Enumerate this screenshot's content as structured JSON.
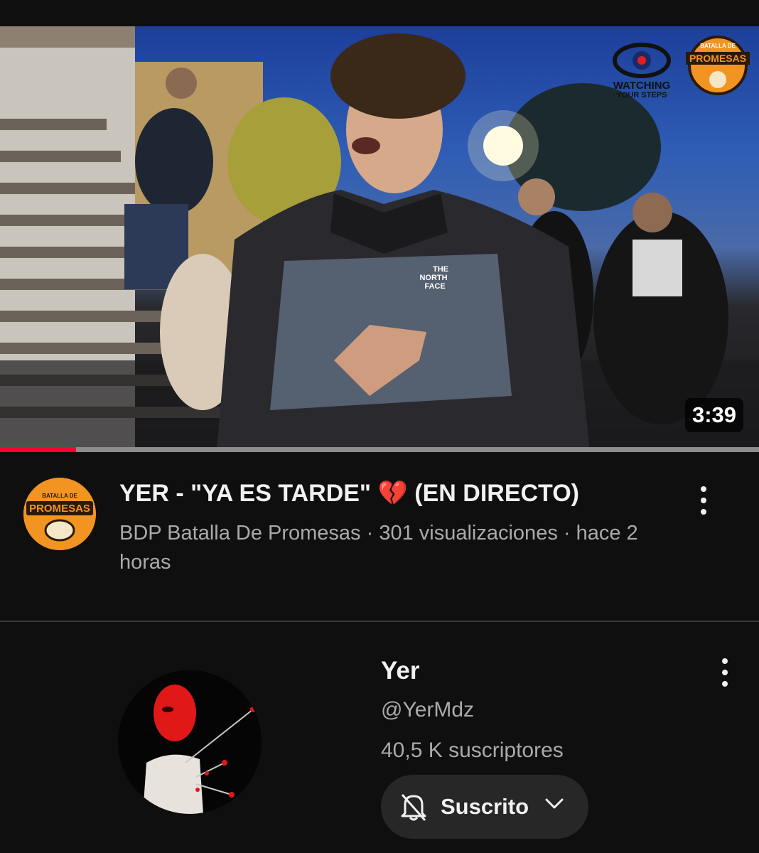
{
  "video": {
    "duration": "3:39",
    "progress_fraction": 0.1,
    "thumbnail_logos": {
      "watching_line1": "WATCHING",
      "watching_line2": "YOUR STEPS",
      "batalla_small": "BATALLA DE",
      "batalla_big": "PROMESAS",
      "jacket_line1": "THE",
      "jacket_line2": "NORTH",
      "jacket_line3": "FACE"
    },
    "title": "YER - \"YA ES TARDE\" 💔 (EN DIRECTO)",
    "meta": "BDP Batalla De Promesas · 301 visualizaciones · hace 2 horas",
    "channel_logo_small": "BATALLA DE",
    "channel_logo_big": "PROMESAS"
  },
  "creator": {
    "name": "Yer",
    "handle": "@YerMdz",
    "subscribers": "40,5 K suscriptores",
    "subscribe_label": "Suscrito"
  },
  "colors": {
    "background": "#0f0f0f",
    "progress": "#ff0033",
    "accent_orange": "#f29422"
  },
  "icons": [
    "more-vert-icon",
    "bell-off-icon",
    "chevron-down-icon"
  ]
}
